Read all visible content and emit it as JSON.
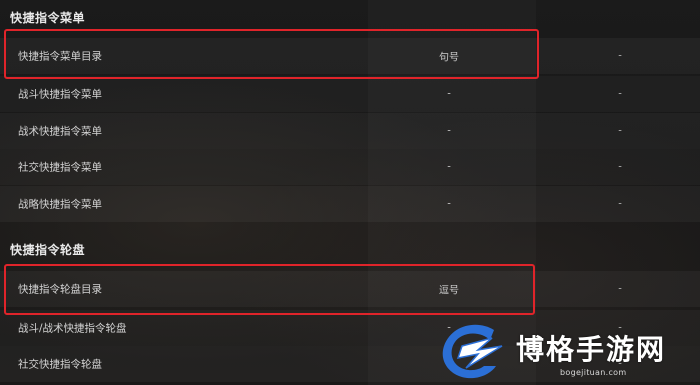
{
  "sections": [
    {
      "title": "快捷指令菜单",
      "rows": [
        {
          "label": "快捷指令菜单目录",
          "value": "句号",
          "value2": "-"
        },
        {
          "label": "战斗快捷指令菜单",
          "value": "-",
          "value2": "-"
        },
        {
          "label": "战术快捷指令菜单",
          "value": "-",
          "value2": "-"
        },
        {
          "label": "社交快捷指令菜单",
          "value": "-",
          "value2": "-"
        },
        {
          "label": "战略快捷指令菜单",
          "value": "-",
          "value2": "-"
        }
      ]
    },
    {
      "title": "快捷指令轮盘",
      "rows": [
        {
          "label": "快捷指令轮盘目录",
          "value": "逗号",
          "value2": "-"
        },
        {
          "label": "战斗/战术快捷指令轮盘",
          "value": "-",
          "value2": "-"
        },
        {
          "label": "社交快捷指令轮盘",
          "value": "-",
          "value2": "-"
        }
      ]
    }
  ],
  "watermark": {
    "logo": "lightning-c-logo-icon",
    "text": "博格手游网",
    "url": "bogejituan.com"
  },
  "colors": {
    "highlight": "#e0242a",
    "watermark_blue": "#2b6fd6"
  }
}
